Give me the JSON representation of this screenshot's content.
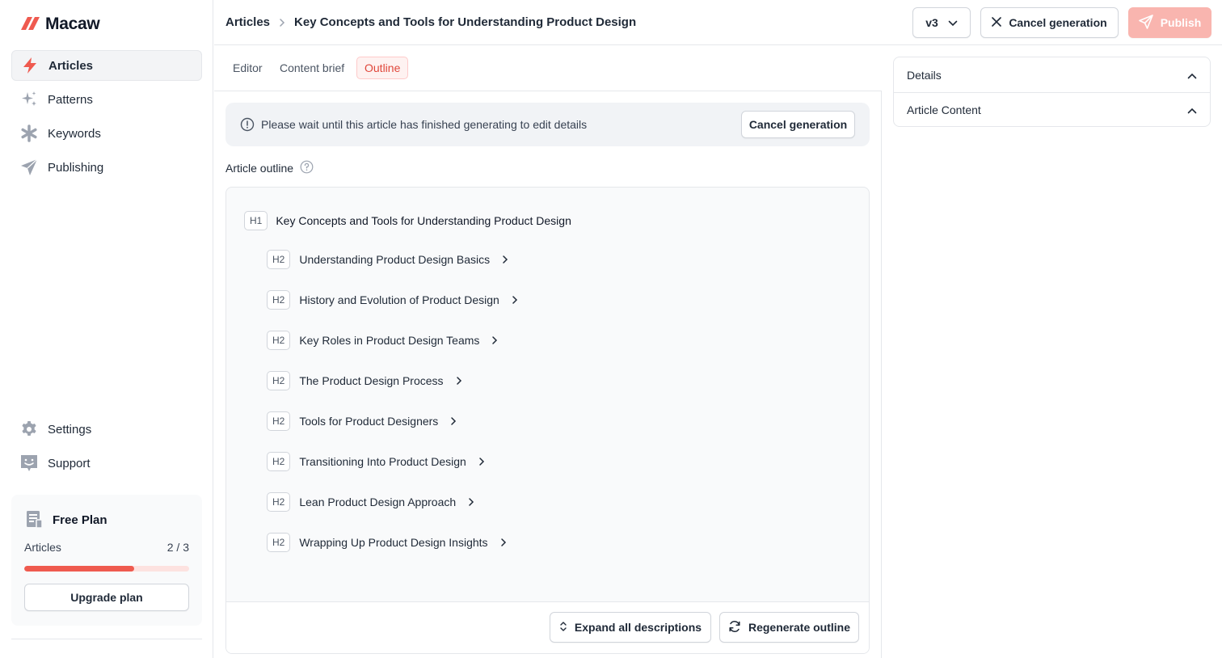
{
  "app": {
    "name": "Macaw",
    "brand_color": "#ef5a4f"
  },
  "sidebar": {
    "nav": [
      {
        "label": "Articles",
        "icon": "bolt-icon",
        "active": true
      },
      {
        "label": "Patterns",
        "icon": "sparkles-icon",
        "active": false
      },
      {
        "label": "Keywords",
        "icon": "asterisk-icon",
        "active": false
      },
      {
        "label": "Publishing",
        "icon": "paper-plane-icon",
        "active": false
      }
    ],
    "bottom_nav": [
      {
        "label": "Settings",
        "icon": "gear-icon"
      },
      {
        "label": "Support",
        "icon": "smiley-chat-icon"
      }
    ],
    "plan": {
      "title": "Free Plan",
      "usage_label": "Articles",
      "usage_value": "2 / 3",
      "usage_fraction": 0.667,
      "upgrade_label": "Upgrade plan"
    }
  },
  "header": {
    "breadcrumb": [
      "Articles",
      "Key Concepts and Tools for Understanding Product Design"
    ],
    "version": "v3",
    "cancel_label": "Cancel generation",
    "publish_label": "Publish"
  },
  "tabs": [
    {
      "label": "Editor",
      "active": false
    },
    {
      "label": "Content brief",
      "active": false
    },
    {
      "label": "Outline",
      "active": true
    }
  ],
  "alert": {
    "text": "Please wait until this article has finished generating to edit details",
    "button_label": "Cancel generation"
  },
  "outline": {
    "label": "Article outline",
    "h1": {
      "tag": "H1",
      "text": "Key Concepts and Tools for Understanding Product Design"
    },
    "h2": [
      {
        "tag": "H2",
        "text": "Understanding Product Design Basics"
      },
      {
        "tag": "H2",
        "text": "History and Evolution of Product Design"
      },
      {
        "tag": "H2",
        "text": "Key Roles in Product Design Teams"
      },
      {
        "tag": "H2",
        "text": "The Product Design Process"
      },
      {
        "tag": "H2",
        "text": "Tools for Product Designers"
      },
      {
        "tag": "H2",
        "text": "Transitioning Into Product Design"
      },
      {
        "tag": "H2",
        "text": "Lean Product Design Approach"
      },
      {
        "tag": "H2",
        "text": "Wrapping Up Product Design Insights"
      }
    ],
    "expand_label": "Expand all descriptions",
    "regenerate_label": "Regenerate outline"
  },
  "right_panel": {
    "sections": [
      {
        "label": "Details",
        "expanded": true
      },
      {
        "label": "Article Content",
        "expanded": true
      }
    ]
  }
}
